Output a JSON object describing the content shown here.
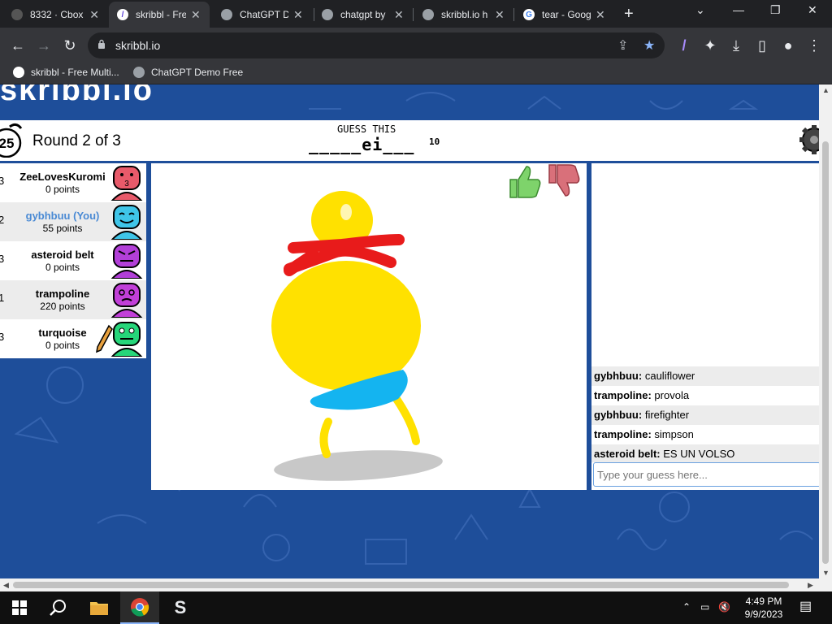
{
  "browser": {
    "tabs": [
      {
        "title": "8332 · Cbox"
      },
      {
        "title": "skribbl - Free Multiplayer"
      },
      {
        "title": "ChatGPT Demo Free"
      },
      {
        "title": "chatgpt by"
      },
      {
        "title": "skribbl.io h"
      },
      {
        "title": "tear - Google"
      }
    ],
    "new_tab": "+",
    "url": "skribbl.io",
    "bookmarks": [
      {
        "title": "skribbl - Free Multi..."
      },
      {
        "title": "ChatGPT Demo Free"
      }
    ]
  },
  "game": {
    "logo_text": "skribbl.io",
    "timer": "25",
    "round": "Round 2 of 3",
    "guess_label": "GUESS THIS",
    "word_hint": "_____ei___",
    "word_length": "10",
    "players": [
      {
        "rank": "3",
        "name": "ZeeLovesKuromi",
        "points": "0 points",
        "color": "#e85a6a"
      },
      {
        "rank": "2",
        "name": "gybhbuu (You)",
        "points": "55 points",
        "color": "#3fc5e8"
      },
      {
        "rank": "3",
        "name": "asteroid belt",
        "points": "0 points",
        "color": "#b23fd8"
      },
      {
        "rank": "1",
        "name": "trampoline",
        "points": "220 points",
        "color": "#c13fd8"
      },
      {
        "rank": "3",
        "name": "turquoise",
        "points": "0 points",
        "color": "#26d67a"
      }
    ]
  },
  "chat": {
    "messages": [
      {
        "user": "gybhbuu:",
        "text": "cauliflower"
      },
      {
        "user": "trampoline:",
        "text": "provola"
      },
      {
        "user": "gybhbuu:",
        "text": "firefighter"
      },
      {
        "user": "trampoline:",
        "text": "simpson"
      },
      {
        "user": "asteroid belt:",
        "text": "ES UN VOLSO"
      }
    ],
    "input_placeholder": "Type your guess here..."
  },
  "taskbar": {
    "time": "4:49 PM",
    "date": "9/9/2023"
  },
  "colors": {
    "page_bg": "#1e4e9a",
    "yellow": "#ffe100",
    "red": "#e81b1b",
    "blue": "#14b4f0",
    "gray": "#c8c8c8"
  }
}
